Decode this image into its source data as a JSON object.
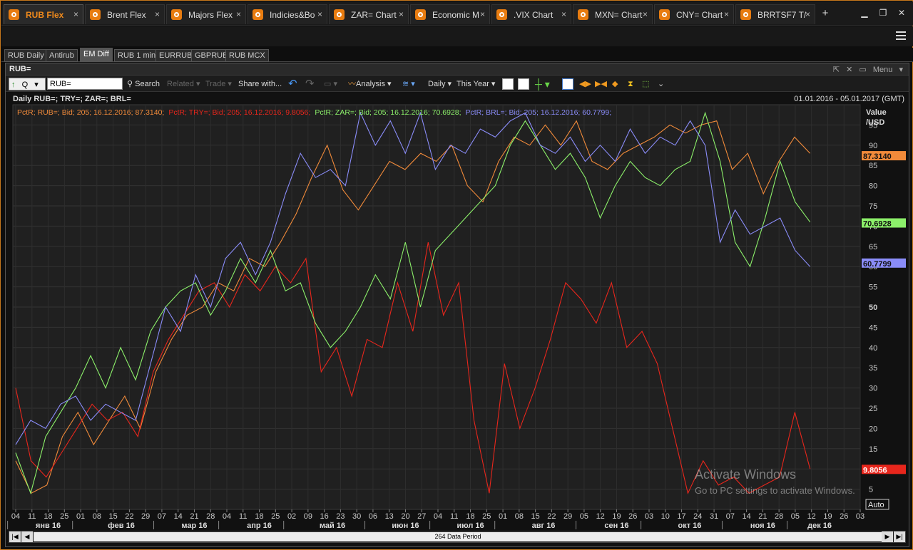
{
  "tabs": [
    {
      "label": "RUB Flex",
      "active": true
    },
    {
      "label": "Brent Flex"
    },
    {
      "label": "Majors Flex"
    },
    {
      "label": "Indicies&Bo"
    },
    {
      "label": "ZAR= Chart"
    },
    {
      "label": "Economic M"
    },
    {
      "label": ".VIX Chart"
    },
    {
      "label": "MXN= Chart"
    },
    {
      "label": "CNY= Chart"
    },
    {
      "label": "BRRTSF7 T/"
    }
  ],
  "tab_close": "×",
  "tab_add": "+",
  "window": {
    "minimize": "▁",
    "restore": "❐",
    "close": "✕"
  },
  "subtabs": [
    "RUB Daily",
    "Antirub",
    "EM Diff",
    "RUB 1 min",
    "EURRUB",
    "GBPRUB",
    "RUB MCX"
  ],
  "subtab_active": "EM Diff",
  "panel": {
    "title": "RUB=",
    "menu_label": "Menu"
  },
  "toolbar": {
    "q_label": "Q",
    "ric_value": "RUB=",
    "search": "Search",
    "related": "Related",
    "trade": "Trade",
    "share": "Share with...",
    "analysis": "Analysis",
    "interval": "Daily",
    "period": "This Year"
  },
  "chart_header": {
    "title": "Daily RUB=; TRY=; ZAR=; BRL=",
    "date_range": "01.01.2016 - 05.01.2017 (GMT)"
  },
  "scroll_label": "264 Data Period",
  "auto_label": "Auto",
  "watermark": {
    "line1": "Activate Windows",
    "line2": "Go to PC settings to activate Windows."
  },
  "colors": {
    "RUB": "#f08a3a",
    "TRY": "#e8261c",
    "ZAR": "#8cf06a",
    "BRL": "#8a8cf8",
    "accent": "#f08a1c"
  },
  "chart_data": {
    "type": "line",
    "y_axis_label": [
      "Value",
      "/USD"
    ],
    "ylim": [
      0,
      100
    ],
    "yticks": [
      5,
      10,
      15,
      20,
      25,
      30,
      35,
      40,
      45,
      50,
      55,
      60,
      65,
      70,
      75,
      80,
      85,
      90,
      95
    ],
    "grid": true,
    "x_day_ticks": [
      "04",
      "11",
      "18",
      "25",
      "01",
      "08",
      "15",
      "22",
      "29",
      "07",
      "14",
      "21",
      "28",
      "04",
      "11",
      "18",
      "25",
      "02",
      "09",
      "16",
      "23",
      "30",
      "06",
      "13",
      "20",
      "27",
      "04",
      "11",
      "18",
      "25",
      "01",
      "08",
      "15",
      "22",
      "29",
      "05",
      "12",
      "19",
      "26",
      "03",
      "10",
      "17",
      "24",
      "31",
      "07",
      "14",
      "21",
      "28",
      "05",
      "12",
      "19",
      "26",
      "03"
    ],
    "x_months": [
      "янв 16",
      "фев 16",
      "мар 16",
      "апр 16",
      "май 16",
      "июн 16",
      "июл 16",
      "авг 16",
      "сен 16",
      "окт 16",
      "ноя 16",
      "дек 16"
    ],
    "legend": [
      {
        "name": "RUB",
        "text": "PctR; RUB=; Bid;  205;  16.12.2016; 87.3140",
        "last": "87.3140"
      },
      {
        "name": "TRY",
        "text": "PctR; TRY=; Bid;  205;  16.12.2016; 9.8056",
        "last": "9.8056"
      },
      {
        "name": "ZAR",
        "text": "PctR; ZAR=; Bid;  205;  16.12.2016; 70.6928",
        "last": "70.6928"
      },
      {
        "name": "BRL",
        "text": "PctR; BRL=; Bid;  205;  16.12.2016; 60.7799",
        "last": "60.7799"
      }
    ],
    "series": [
      {
        "name": "RUB",
        "x_week": [
          0,
          1,
          2,
          3,
          4,
          5,
          6,
          7,
          8,
          9,
          10,
          11,
          12,
          13,
          14,
          15,
          16,
          17,
          18,
          19,
          20,
          21,
          22,
          23,
          24,
          25,
          26,
          27,
          28,
          29,
          30,
          31,
          32,
          33,
          34,
          35,
          36,
          37,
          38,
          39,
          40,
          41,
          42,
          43,
          44,
          45,
          46,
          47,
          48,
          49,
          50
        ],
        "values": [
          12,
          4,
          6,
          18,
          24,
          16,
          22,
          28,
          20,
          34,
          42,
          48,
          50,
          56,
          54,
          62,
          60,
          66,
          73,
          82,
          90,
          79,
          74,
          80,
          86,
          84,
          88,
          86,
          90,
          80,
          76,
          86,
          92,
          90,
          95,
          90,
          96,
          86,
          84,
          88,
          90,
          92,
          95,
          93,
          95,
          96,
          84,
          88,
          78,
          86,
          92,
          88
        ]
      },
      {
        "name": "TRY",
        "x_week": [
          0,
          1,
          2,
          3,
          4,
          5,
          6,
          7,
          8,
          9,
          10,
          11,
          12,
          13,
          14,
          15,
          16,
          17,
          18,
          19,
          20,
          21,
          22,
          23,
          24,
          25,
          26,
          27,
          28,
          29,
          30,
          31,
          32,
          33,
          34,
          35,
          36,
          37,
          38,
          39,
          40,
          41,
          42,
          43,
          44,
          45,
          46,
          47,
          48,
          49,
          50
        ],
        "values": [
          30,
          12,
          8,
          14,
          20,
          26,
          22,
          24,
          18,
          34,
          42,
          48,
          54,
          56,
          50,
          58,
          54,
          60,
          56,
          62,
          34,
          40,
          28,
          42,
          40,
          56,
          44,
          66,
          48,
          56,
          22,
          4,
          36,
          20,
          30,
          42,
          56,
          52,
          46,
          56,
          40,
          44,
          36,
          20,
          4,
          12,
          6,
          8,
          4,
          6,
          8,
          24,
          10
        ]
      },
      {
        "name": "ZAR",
        "x_week": [
          0,
          1,
          2,
          3,
          4,
          5,
          6,
          7,
          8,
          9,
          10,
          11,
          12,
          13,
          14,
          15,
          16,
          17,
          18,
          19,
          20,
          21,
          22,
          23,
          24,
          25,
          26,
          27,
          28,
          29,
          30,
          31,
          32,
          33,
          34,
          35,
          36,
          37,
          38,
          39,
          40,
          41,
          42,
          43,
          44,
          45,
          46,
          47,
          48,
          49,
          50
        ],
        "values": [
          14,
          4,
          18,
          24,
          30,
          38,
          30,
          40,
          32,
          44,
          50,
          54,
          56,
          48,
          54,
          62,
          56,
          64,
          54,
          56,
          46,
          40,
          44,
          50,
          58,
          52,
          66,
          50,
          64,
          68,
          72,
          76,
          80,
          90,
          96,
          90,
          84,
          88,
          82,
          72,
          80,
          86,
          82,
          80,
          84,
          86,
          98,
          86,
          66,
          60,
          72,
          86,
          76,
          71
        ]
      },
      {
        "name": "BRL",
        "x_week": [
          0,
          1,
          2,
          3,
          4,
          5,
          6,
          7,
          8,
          9,
          10,
          11,
          12,
          13,
          14,
          15,
          16,
          17,
          18,
          19,
          20,
          21,
          22,
          23,
          24,
          25,
          26,
          27,
          28,
          29,
          30,
          31,
          32,
          33,
          34,
          35,
          36,
          37,
          38,
          39,
          40,
          41,
          42,
          43,
          44,
          45,
          46,
          47,
          48,
          49,
          50
        ],
        "values": [
          16,
          22,
          20,
          26,
          28,
          22,
          26,
          24,
          22,
          36,
          50,
          44,
          58,
          50,
          62,
          66,
          58,
          66,
          78,
          88,
          82,
          84,
          80,
          98,
          90,
          96,
          88,
          98,
          84,
          90,
          88,
          94,
          92,
          96,
          98,
          90,
          88,
          92,
          86,
          90,
          86,
          94,
          88,
          92,
          90,
          96,
          90,
          66,
          74,
          68,
          70,
          72,
          64,
          60
        ]
      }
    ]
  }
}
